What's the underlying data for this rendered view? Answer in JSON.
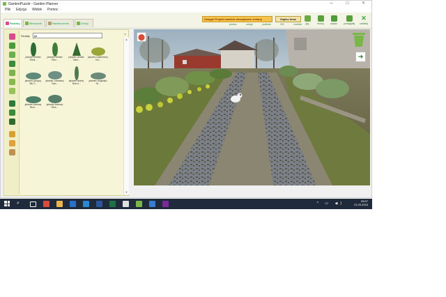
{
  "window": {
    "title": "GardenPuzzle - Garden Planner"
  },
  "menu": [
    "Plik",
    "Edycja",
    "Widok",
    "Pomoc"
  ],
  "tabs": [
    {
      "label": "Rośliny",
      "icon": "flower-icon",
      "color": "#d94b8c"
    },
    {
      "label": "Mieszanie",
      "icon": "house-icon",
      "color": "#7ab648"
    },
    {
      "label": "Nawierzchnie",
      "icon": "paving-icon",
      "color": "#b0a070"
    },
    {
      "label": "Dodaj",
      "icon": "add-icon",
      "color": "#7ab648"
    }
  ],
  "toolbar": {
    "warning": "Uwaga! Projekt zawiera niezapisane zmiany",
    "save_label": "Zapisz teraz",
    "sublinks": [
      "pomoc",
      "usługi",
      "podłoża",
      "0%",
      "rozmiar"
    ],
    "buttons": [
      {
        "label": "jpg",
        "icon": "jpg-icon",
        "color": "#5aa03c"
      },
      {
        "label": "drukuj",
        "icon": "print-icon",
        "color": "#5aa03c"
      },
      {
        "label": "zapisz",
        "icon": "save-icon",
        "color": "#5aa03c"
      },
      {
        "label": "przeglądaj",
        "icon": "browse-icon",
        "color": "#5aa03c"
      },
      {
        "label": "zamknij",
        "icon": "close-icon",
        "color": "#3aa53a"
      }
    ]
  },
  "library": {
    "search_label": "Szukaj:",
    "search_value": "jał",
    "categories": [
      {
        "icon": "flower-category-icon",
        "color": "#d94b8c"
      },
      {
        "icon": "shrub-category-icon",
        "color": "#4a9a3a"
      },
      {
        "icon": "tree-category-icon",
        "color": "#6ab04c"
      },
      {
        "icon": "hedge-category-icon",
        "color": "#3d8a3d"
      },
      {
        "icon": "climber-category-icon",
        "color": "#7fb24a"
      },
      {
        "icon": "grass-category-icon",
        "color": "#89b84c"
      },
      {
        "icon": "bulb-category-icon",
        "color": "#9ac25a"
      },
      {
        "icon": "conifer-category-icon",
        "color": "#2f7a3a"
      },
      {
        "icon": "fruit-tree-category-icon",
        "color": "#3a8a3a"
      },
      {
        "icon": "tall-tree-category-icon",
        "color": "#2d6a2d"
      },
      {
        "icon": "pot-category-icon",
        "color": "#d8a030"
      },
      {
        "icon": "decor-category-icon",
        "color": "#e0a040"
      },
      {
        "icon": "furniture-category-icon",
        "color": "#c09050"
      }
    ],
    "plants": [
      {
        "label": "jałowiec chiński 'Obeli...",
        "color": "#2e6b35",
        "shape": "columnar"
      },
      {
        "label": "jałowiec chiński 'Stric...",
        "color": "#3f7d3a",
        "shape": "columnar"
      },
      {
        "label": "jałowiec chiński 'Varie...",
        "color": "#356b30",
        "shape": "cone"
      },
      {
        "label": "jałowiec nadbrzeżny 'Gol...",
        "color": "#9aa63a",
        "shape": "spread"
      },
      {
        "label": "jałowiec płożący 'Blu C...",
        "color": "#5f8a7a",
        "shape": "low"
      },
      {
        "label": "jałowiec rozesłany 'Nan...",
        "color": "#6f8f85",
        "shape": "spread"
      },
      {
        "label": "jałowiec skalny 'Blue A...",
        "color": "#4f7a55",
        "shape": "thin"
      },
      {
        "label": "jałowiec wirginijski 'Gr...",
        "color": "#6a8a7a",
        "shape": "low"
      },
      {
        "label": "jałowiec łuskowy 'Blue...",
        "color": "#4e7f68",
        "shape": "low"
      },
      {
        "label": "jałowiec łuskowy 'Blue...",
        "color": "#577f6c",
        "shape": "spread"
      }
    ]
  },
  "taskbar": {
    "time": "09:07",
    "date": "21.03.2016",
    "apps": [
      {
        "icon": "search-icon",
        "color": "#1f2b3a"
      },
      {
        "icon": "task-view-icon",
        "color": "#1f2b3a"
      },
      {
        "icon": "chrome-icon",
        "color": "#d94b3a"
      },
      {
        "icon": "explorer-icon",
        "color": "#e8b84a"
      },
      {
        "icon": "outlook-icon",
        "color": "#2a6fc9"
      },
      {
        "icon": "store-icon",
        "color": "#2a88d0"
      },
      {
        "icon": "word-icon",
        "color": "#2b5797"
      },
      {
        "icon": "excel-icon",
        "color": "#1e7145"
      },
      {
        "icon": "notepad-icon",
        "color": "#e0e0e0"
      },
      {
        "icon": "gardenpuzzle-icon",
        "color": "#7ab648"
      },
      {
        "icon": "photos-icon",
        "color": "#3a7bd5"
      },
      {
        "icon": "onenote-icon",
        "color": "#7a2a9a"
      }
    ]
  }
}
